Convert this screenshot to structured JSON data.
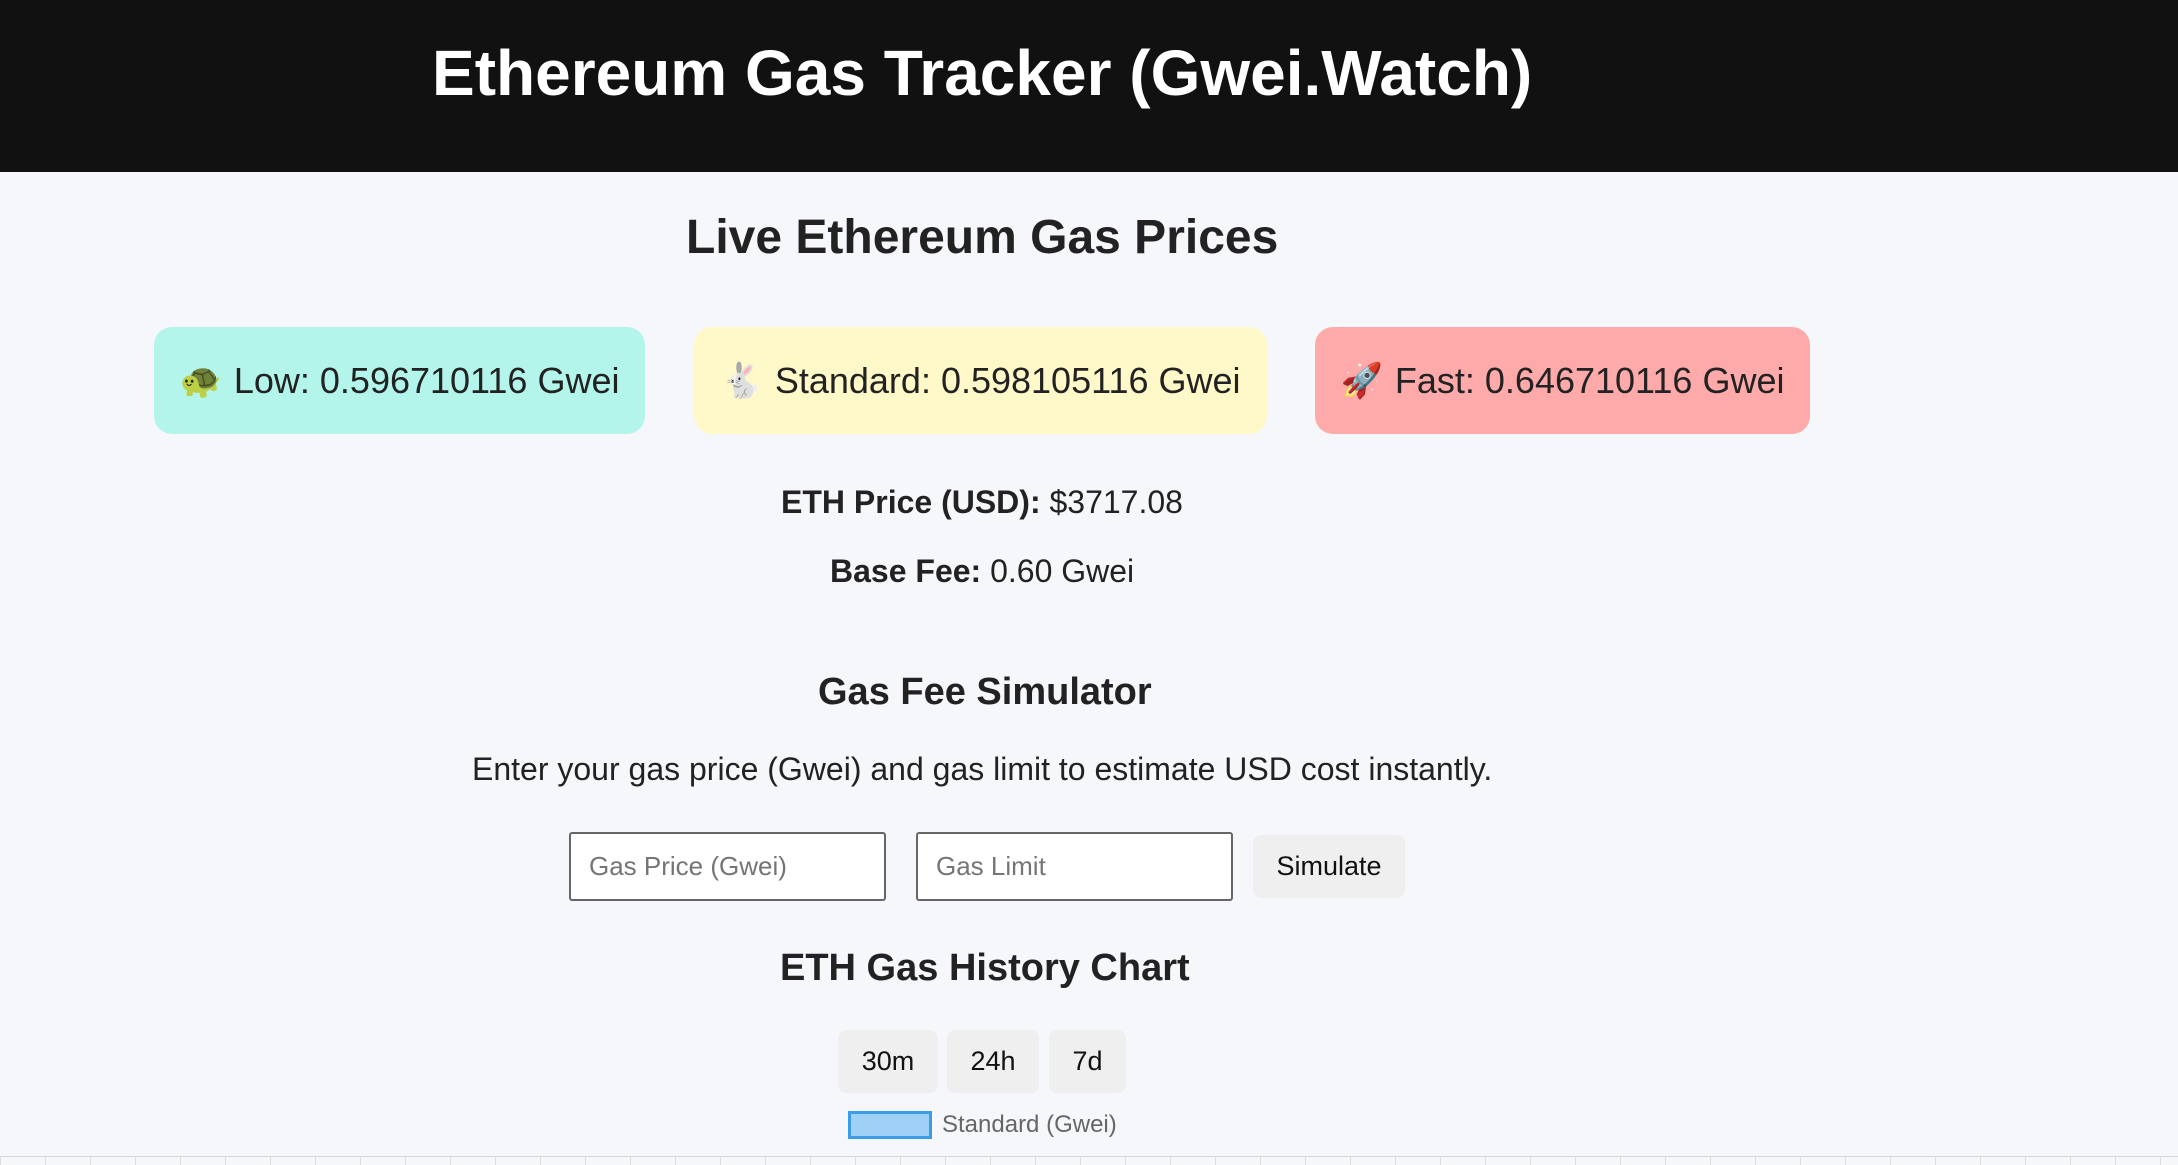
{
  "header": {
    "title": "Ethereum Gas Tracker (Gwei.Watch)"
  },
  "live": {
    "title": "Live Ethereum Gas Prices",
    "cards": [
      {
        "icon": "turtle-icon",
        "emoji": "🐢",
        "text": "Low: 0.596710116 Gwei",
        "color": "#b3f5ea"
      },
      {
        "icon": "rabbit-icon",
        "emoji": "🐇",
        "text": "Standard: 0.598105116 Gwei",
        "color": "#fff9c9"
      },
      {
        "icon": "rocket-icon",
        "emoji": "🚀",
        "text": "Fast: 0.646710116 Gwei",
        "color": "#ffaaaa"
      }
    ],
    "eth_price_label": "ETH Price (USD):",
    "eth_price_value": "$3717.08",
    "base_fee_label": "Base Fee:",
    "base_fee_value": "0.60 Gwei"
  },
  "simulator": {
    "title": "Gas Fee Simulator",
    "description": "Enter your gas price (Gwei) and gas limit to estimate USD cost instantly.",
    "gas_price_placeholder": "Gas Price (Gwei)",
    "gas_limit_placeholder": "Gas Limit",
    "button_label": "Simulate"
  },
  "history": {
    "title": "ETH Gas History Chart",
    "ranges": [
      "30m",
      "24h",
      "7d"
    ],
    "legend_label": "Standard (Gwei)",
    "legend_fill": "#9fd0f5",
    "legend_border": "#3a9ee6"
  }
}
